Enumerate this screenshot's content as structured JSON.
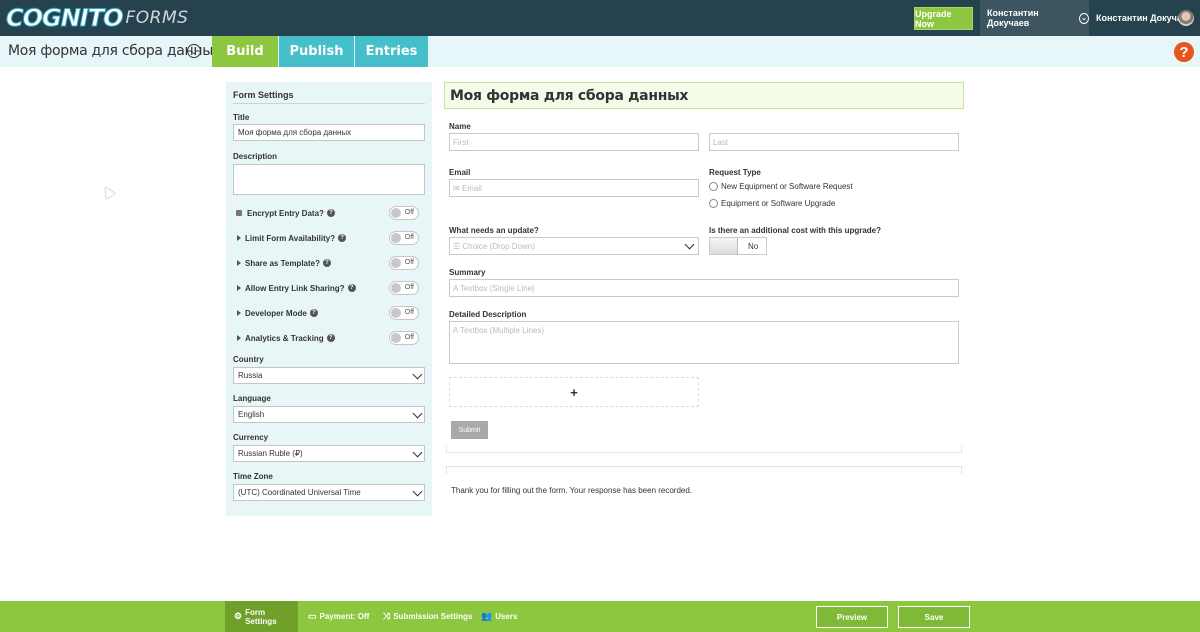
{
  "app": {
    "brand": "COGNITO",
    "brand_suffix": "FORMS",
    "upgrade_label": "Upgrade Now",
    "org_name": "Константин Докучаев",
    "user_name": "Константин Докучаев"
  },
  "navbar": {
    "form_title": "Моя форма для сбора данных",
    "tabs": [
      {
        "label": "Build",
        "active": true
      },
      {
        "label": "Publish",
        "active": false
      },
      {
        "label": "Entries",
        "active": false
      }
    ],
    "help": "?"
  },
  "settings": {
    "heading": "Form Settings",
    "title_label": "Title",
    "title_value": "Моя форма для сбора данных",
    "description_label": "Description",
    "description_value": "",
    "toggles": [
      {
        "label": "Encrypt Entry Data?",
        "state": "Off",
        "icon": "lock-icon"
      },
      {
        "label": "Limit Form Availability?",
        "state": "Off",
        "icon": "caret-right-icon"
      },
      {
        "label": "Share as Template?",
        "state": "Off",
        "icon": "caret-right-icon"
      },
      {
        "label": "Allow Entry Link Sharing?",
        "state": "Off",
        "icon": "caret-right-icon"
      },
      {
        "label": "Developer Mode",
        "state": "Off",
        "icon": "caret-right-icon"
      },
      {
        "label": "Analytics & Tracking",
        "state": "Off",
        "icon": "caret-right-icon"
      }
    ],
    "country_label": "Country",
    "country_value": "Russia",
    "language_label": "Language",
    "language_value": "English",
    "currency_label": "Currency",
    "currency_value": "Russian Ruble (₽)",
    "timezone_label": "Time Zone",
    "timezone_value": "(UTC) Coordinated Universal Time"
  },
  "form": {
    "title": "Моя форма для сбора данных",
    "name_label": "Name",
    "first_placeholder": "First",
    "last_placeholder": "Last",
    "email_label": "Email",
    "email_placeholder": "Email",
    "request_type_label": "Request Type",
    "request_options": [
      "New Equipment or Software Request",
      "Equipment or Software Upgrade"
    ],
    "update_label": "What needs an update?",
    "update_placeholder": "Choice (Drop Down)",
    "cost_label": "Is there an additional cost with this upgrade?",
    "cost_value": "No",
    "summary_label": "Summary",
    "summary_placeholder": "Textbox (Single Line)",
    "detail_label": "Detailed Description",
    "detail_placeholder": "Textbox (Multiple Lines)",
    "add_symbol": "+",
    "submit_label": "Submit",
    "confirmation": "Thank you for filling out the form. Your response has been recorded."
  },
  "bottombar": {
    "items": [
      {
        "label": "Form Settings",
        "icon": "gear-icon",
        "active": true
      },
      {
        "label": "Payment: Off",
        "icon": "card-icon",
        "active": false
      },
      {
        "label": "Submission Settings",
        "icon": "shuffle-icon",
        "active": false
      },
      {
        "label": "Users",
        "icon": "users-icon",
        "active": false
      }
    ],
    "preview_label": "Preview",
    "save_label": "Save"
  },
  "colors": {
    "topbar": "#26424f",
    "accent_green": "#8dc63f",
    "accent_teal": "#45c0ca",
    "help_orange": "#e8551b",
    "panel_bg": "#e9f6f7"
  }
}
